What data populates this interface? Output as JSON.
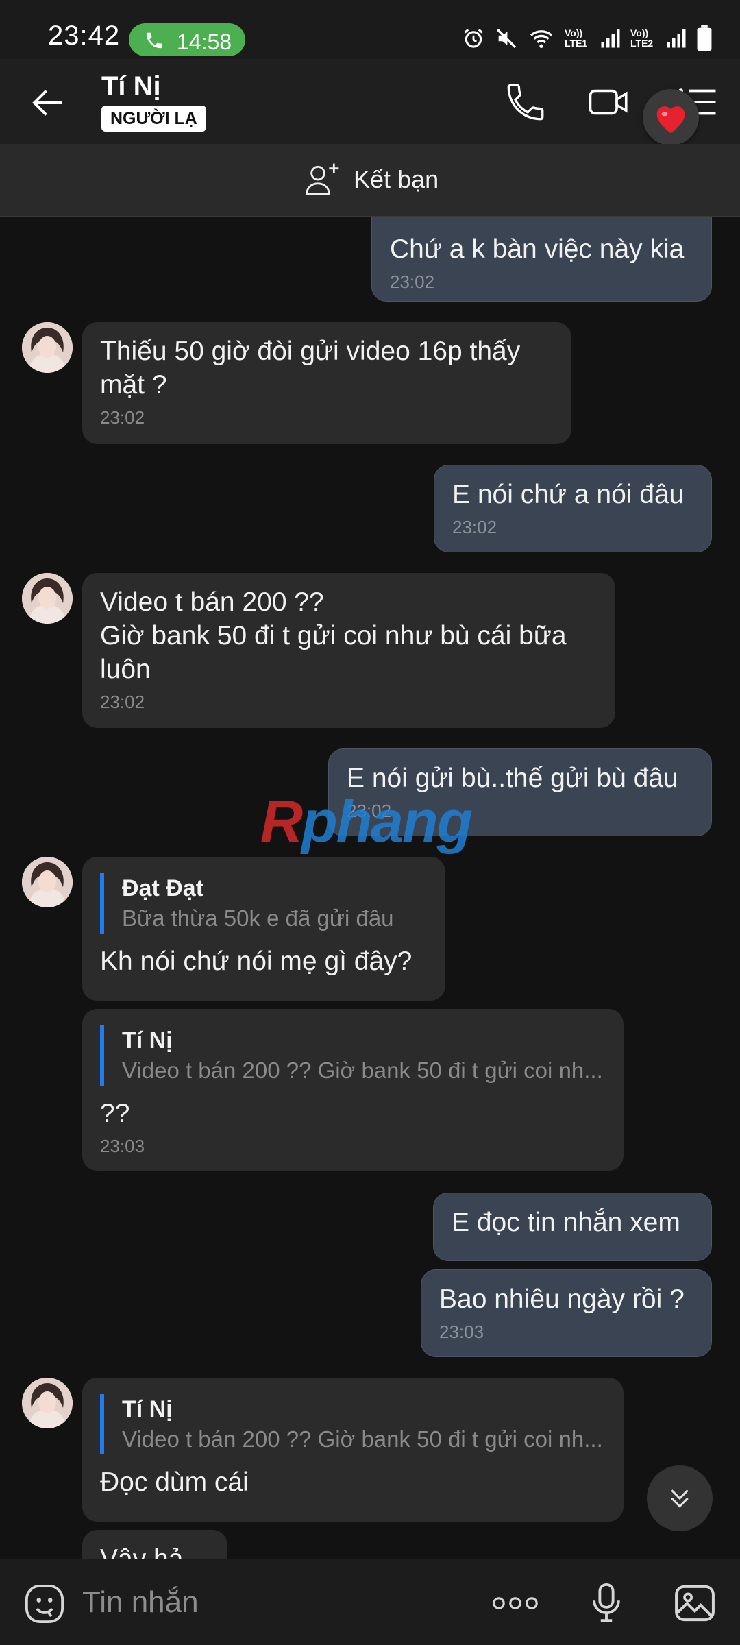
{
  "status_bar": {
    "time": "23:42",
    "call_duration": "14:58",
    "sim1_label": "Vo)) LTE1",
    "sim2_label": "Vo)) LTE2",
    "icons": [
      "alarm-icon",
      "mute-icon",
      "wifi-icon",
      "signal-icon",
      "battery-icon"
    ]
  },
  "header": {
    "name": "Tí Nị",
    "badge": "NGƯỜI LẠ",
    "icons": [
      "back-arrow-icon",
      "phone-icon",
      "video-call-icon",
      "menu-icon",
      "heart-icon"
    ]
  },
  "add_friend": {
    "label": "Kết bạn",
    "icon": "add-person-icon"
  },
  "messages": [
    {
      "direction": "out",
      "text": "Chứ a k bàn việc này kia",
      "time": "23:02"
    },
    {
      "direction": "in",
      "text": "Thiếu 50 giờ đòi gửi video 16p thấy mặt ?",
      "time": "23:02"
    },
    {
      "direction": "out",
      "text": "E nói chứ a nói đâu",
      "time": "23:02"
    },
    {
      "direction": "in",
      "line1": "Video t bán 200 ??",
      "line2": "Giờ bank 50 đi t gửi coi như bù cái bữa luôn",
      "time": "23:02"
    },
    {
      "direction": "out",
      "text": "E nói gửi bù..thế gửi bù đâu",
      "time": "23:02"
    },
    {
      "direction": "in",
      "quote_author": "Đạt Đạt",
      "quote_text": "Bữa thừa 50k e đã gửi đâu",
      "text": "Kh nói chứ nói mẹ gì đây?"
    },
    {
      "direction": "in",
      "quote_author": "Tí Nị",
      "quote_text": "Video t bán 200 ??  Giờ bank 50 đi t gửi coi nh...",
      "text": "??",
      "time": "23:03"
    },
    {
      "direction": "out",
      "text": "E đọc tin nhắn xem"
    },
    {
      "direction": "out",
      "text": "Bao nhiêu ngày rồi ?",
      "time": "23:03"
    },
    {
      "direction": "in",
      "quote_author": "Tí Nị",
      "quote_text": "Video t bán 200 ??  Giờ bank 50 đi t gửi coi nh...",
      "text": "Đọc dùm cái"
    },
    {
      "direction": "in",
      "text": "Vậy hả..."
    }
  ],
  "watermark": {
    "first": "R",
    "rest": "phang"
  },
  "composer": {
    "placeholder": "Tin nhắn",
    "icons": [
      "emoji-icon",
      "more-options-icon",
      "microphone-icon",
      "image-icon"
    ]
  },
  "scroll_down_icon": "double-chevron-down-icon",
  "colors": {
    "outgoing_bubble": "#3b4452",
    "incoming_bubble": "#2b2b2b",
    "quote_bar": "#1e7bf2",
    "call_pill": "#4cb050"
  }
}
